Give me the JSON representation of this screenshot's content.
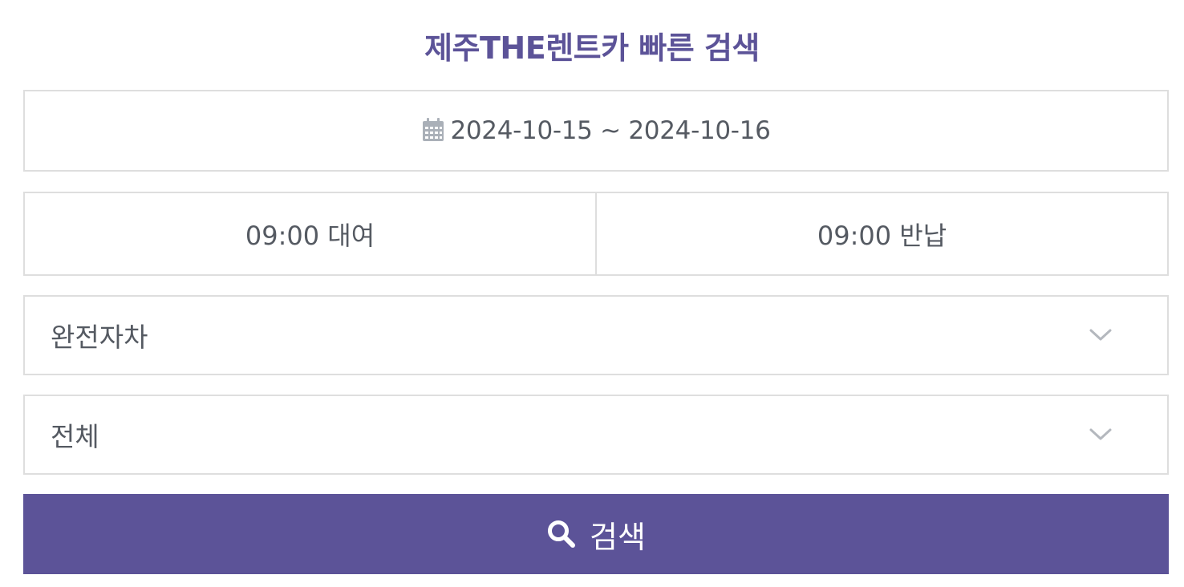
{
  "title": "제주THE렌트카 빠른 검색",
  "date_range": {
    "icon": "calendar-icon",
    "text": "2024-10-15 ~ 2024-10-16"
  },
  "times": {
    "pickup": "09:00 대여",
    "return": "09:00 반납"
  },
  "selects": {
    "insurance": {
      "value": "완전자차",
      "icon": "chevron-down-icon"
    },
    "car_type": {
      "value": "전체",
      "icon": "chevron-down-icon"
    }
  },
  "search_button": {
    "label": "검색",
    "icon": "search-icon"
  },
  "colors": {
    "accent": "#5c5398",
    "text": "#555a62",
    "border": "#dedede",
    "icon_gray": "#aab0b8"
  }
}
